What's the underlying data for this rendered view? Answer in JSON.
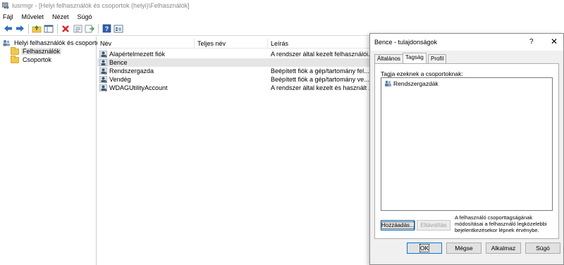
{
  "window": {
    "title": "lusrmgr - [Helyi felhasználók és csoportok (helyi)\\Felhasználók]"
  },
  "menu": [
    "Fájl",
    "Művelet",
    "Nézet",
    "Súgó"
  ],
  "toolbar": {
    "icons": [
      "back-arrow-icon",
      "forward-arrow-icon",
      "up-folder-icon",
      "show-hide-tree-icon",
      "delete-icon",
      "properties-icon",
      "export-list-icon",
      "help-icon",
      "view-icon"
    ]
  },
  "tree": {
    "root": "Helyi felhasználók és csoportok",
    "children": [
      {
        "label": "Felhasználók",
        "selected": true
      },
      {
        "label": "Csoportok",
        "selected": false
      }
    ]
  },
  "list": {
    "columns": [
      "Név",
      "Teljes név",
      "Leírás"
    ],
    "rows": [
      {
        "name": "Alapértelmezett fiók",
        "full_name": "",
        "description": "A rendszer által kezelt felhasználói..."
      },
      {
        "name": "Bence",
        "full_name": "",
        "description": ""
      },
      {
        "name": "Rendszergazda",
        "full_name": "",
        "description": "Beépített fiók a gép/tartomány fel..."
      },
      {
        "name": "Vendég",
        "full_name": "",
        "description": "Beépített fiók a gép/tartomány ve..."
      },
      {
        "name": "WDAGUtilityAccount",
        "full_name": "",
        "description": "A rendszer által kezelt és használt ..."
      }
    ]
  },
  "dialog": {
    "title": "Bence - tulajdonságok",
    "help": "?",
    "close": "✕",
    "tabs": [
      "Általános",
      "Tagság",
      "Profil"
    ],
    "active_tab": "Tagság",
    "member_label": "Tagja ezeknek a csoportoknak:",
    "groups": [
      "Rendszergazdák"
    ],
    "add_button": "Hozzáadás...",
    "remove_button": "Eltávolítás",
    "note": "A felhasználó csoporttagságának módosításai a felhasználó legközelebbi bejelentkezésekor lépnek érvénybe.",
    "ok": "OK",
    "cancel": "Mégse",
    "apply": "Alkalmaz",
    "help_button": "Súgó"
  },
  "colors": {
    "selection": "#e5e5e5",
    "dialog_bg": "#f0f0f0",
    "focus_border": "#0078d7",
    "folder": "#f2c84b"
  }
}
